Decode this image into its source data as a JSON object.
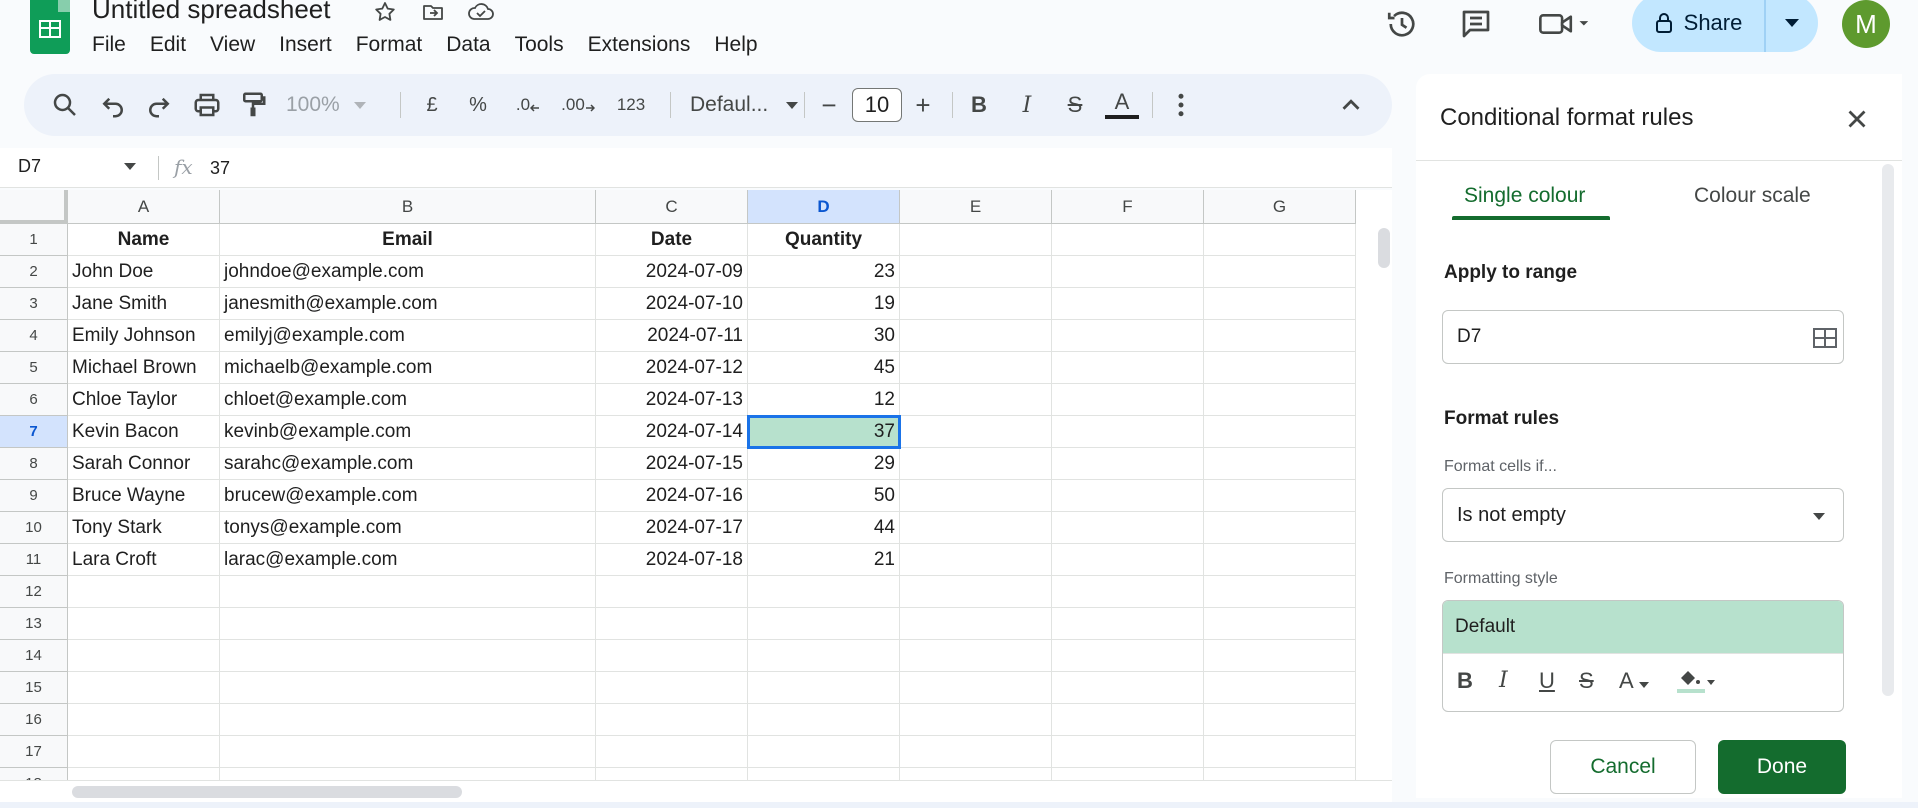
{
  "header": {
    "title": "Untitled spreadsheet",
    "menu": [
      "File",
      "Edit",
      "View",
      "Insert",
      "Format",
      "Data",
      "Tools",
      "Extensions",
      "Help"
    ],
    "share_label": "Share",
    "avatar_letter": "M"
  },
  "toolbar": {
    "zoom": "100%",
    "currency": "£",
    "percent": "%",
    "dec_decrease": ".0",
    "dec_increase": ".00",
    "number_format": "123",
    "font": "Defaul...",
    "font_size": "10",
    "minus": "−",
    "plus": "+",
    "bold": "B",
    "italic": "I",
    "strike": "S",
    "text_color": "A"
  },
  "formula_bar": {
    "name_box": "D7",
    "value": "37"
  },
  "grid": {
    "columns": [
      "A",
      "B",
      "C",
      "D",
      "E",
      "F",
      "G"
    ],
    "selected_column": "D",
    "selected_row": 7,
    "row_numbers": [
      1,
      2,
      3,
      4,
      5,
      6,
      7,
      8,
      9,
      10,
      11,
      12,
      13,
      14,
      15,
      16,
      17,
      18
    ],
    "headers": [
      "Name",
      "Email",
      "Date",
      "Quantity"
    ],
    "rows": [
      [
        "John Doe",
        "johndoe@example.com",
        "2024-07-09",
        "23"
      ],
      [
        "Jane Smith",
        "janesmith@example.com",
        "2024-07-10",
        "19"
      ],
      [
        "Emily Johnson",
        "emilyj@example.com",
        "2024-07-11",
        "30"
      ],
      [
        "Michael Brown",
        "michaelb@example.com",
        "2024-07-12",
        "45"
      ],
      [
        "Chloe Taylor",
        "chloet@example.com",
        "2024-07-13",
        "12"
      ],
      [
        "Kevin Bacon",
        "kevinb@example.com",
        "2024-07-14",
        "37"
      ],
      [
        "Sarah Connor",
        "sarahc@example.com",
        "2024-07-15",
        "29"
      ],
      [
        "Bruce Wayne",
        "brucew@example.com",
        "2024-07-16",
        "50"
      ],
      [
        "Tony Stark",
        "tonys@example.com",
        "2024-07-17",
        "44"
      ],
      [
        "Lara Croft",
        "larac@example.com",
        "2024-07-18",
        "21"
      ]
    ]
  },
  "panel": {
    "title": "Conditional format rules",
    "tabs": [
      "Single colour",
      "Colour scale"
    ],
    "active_tab": "Single colour",
    "apply_label": "Apply to range",
    "range_value": "D7",
    "format_rules_label": "Format rules",
    "format_cells_if_label": "Format cells if...",
    "condition": "Is not empty",
    "formatting_style_label": "Formatting style",
    "style_preview": "Default",
    "style_tools": {
      "bold": "B",
      "italic": "I",
      "underline": "U",
      "strike": "S",
      "text_color": "A"
    },
    "cancel_label": "Cancel",
    "done_label": "Done"
  },
  "colors": {
    "accent_green": "#146c2e",
    "fill_green": "#b7e1cd",
    "selection_blue": "#1a73e8",
    "share_blue": "#c2e7ff",
    "avatar_green": "#5e9a2e"
  }
}
